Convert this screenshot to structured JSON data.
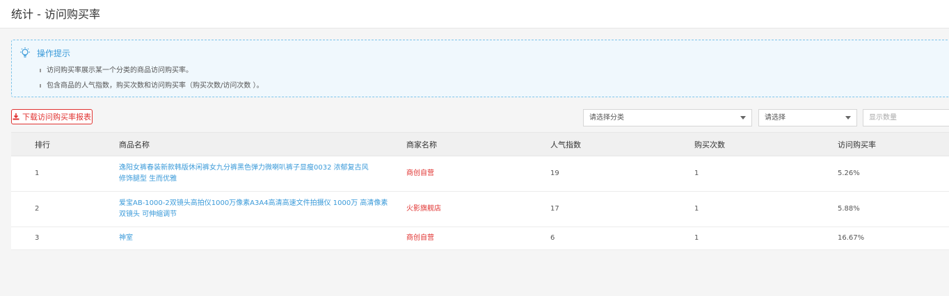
{
  "header": {
    "title": "统计 - 访问购买率"
  },
  "tips": {
    "title": "操作提示",
    "items": [
      "访问购买率展示某一个分类的商品访问购买率。",
      "包含商品的人气指数，购买次数和访问购买率（购买次数/访问次数 ）。"
    ]
  },
  "toolbar": {
    "download_label": "下载访问购买率报表",
    "category_select": "请选择分类",
    "sub_select": "请选择",
    "count_placeholder": "显示数量"
  },
  "table": {
    "headers": [
      "排行",
      "商品名称",
      "商家名称",
      "人气指数",
      "购买次数",
      "访问购买率"
    ],
    "rows": [
      {
        "rank": "1",
        "name_line1": "逸阳女裤春装新款韩版休闲裤女九分裤黑色弹力微喇叭裤子显瘦0032 浓郁复古风",
        "name_line2": "修饰腿型 生而优雅",
        "shop": "商创自营",
        "popularity": "19",
        "purchases": "1",
        "rate": "5.26%"
      },
      {
        "rank": "2",
        "name_line1": "爱宝AB-1000-2双镜头高拍仪1000万像素A3A4高清高速文件拍摄仪 1000万 高清像素",
        "name_line2": "双镜头 可伸缩调节",
        "shop": "火影旗舰店",
        "popularity": "17",
        "purchases": "1",
        "rate": "5.88%"
      },
      {
        "rank": "3",
        "name_line1": "神室",
        "name_line2": "",
        "shop": "商创自营",
        "popularity": "6",
        "purchases": "1",
        "rate": "16.67%"
      }
    ]
  },
  "colors": {
    "accent_blue": "#3a9ad9",
    "accent_red": "#e0312f"
  }
}
